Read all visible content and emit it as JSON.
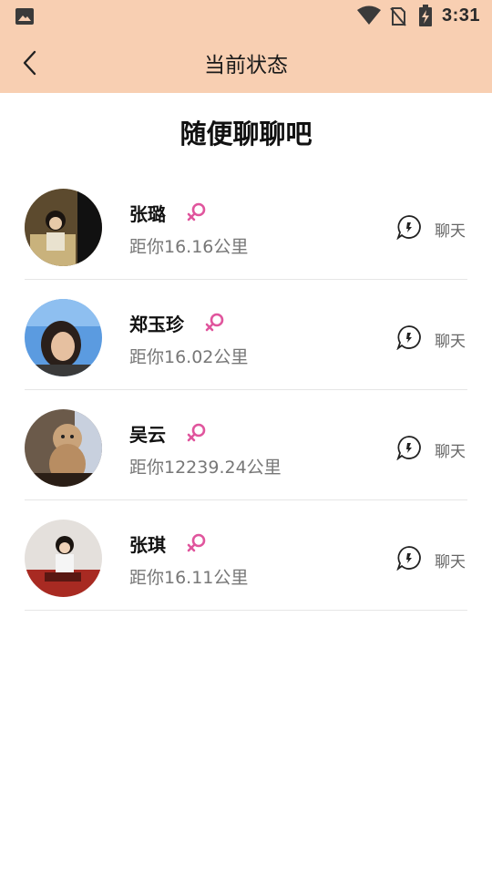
{
  "status_bar": {
    "time": "3:31",
    "icons": [
      "gallery-icon",
      "wifi-icon",
      "no-sim-icon",
      "battery-charging-icon"
    ]
  },
  "header": {
    "title": "当前状态",
    "back_icon": "chevron-left-icon",
    "background_color": "#f8cfb2"
  },
  "section_heading": "随便聊聊吧",
  "users": [
    {
      "name": "张璐",
      "distance": "距你16.16公里",
      "gender_icon": "female-icon",
      "chat_label": "聊天"
    },
    {
      "name": "郑玉珍",
      "distance": "距你16.02公里",
      "gender_icon": "female-icon",
      "chat_label": "聊天"
    },
    {
      "name": "吴云",
      "distance": "距你12239.24公里",
      "gender_icon": "female-icon",
      "chat_label": "聊天"
    },
    {
      "name": "张琪",
      "distance": "距你16.11公里",
      "gender_icon": "female-icon",
      "chat_label": "聊天"
    }
  ],
  "colors": {
    "gender_pink": "#e0559d",
    "distance_gray": "#777777"
  }
}
